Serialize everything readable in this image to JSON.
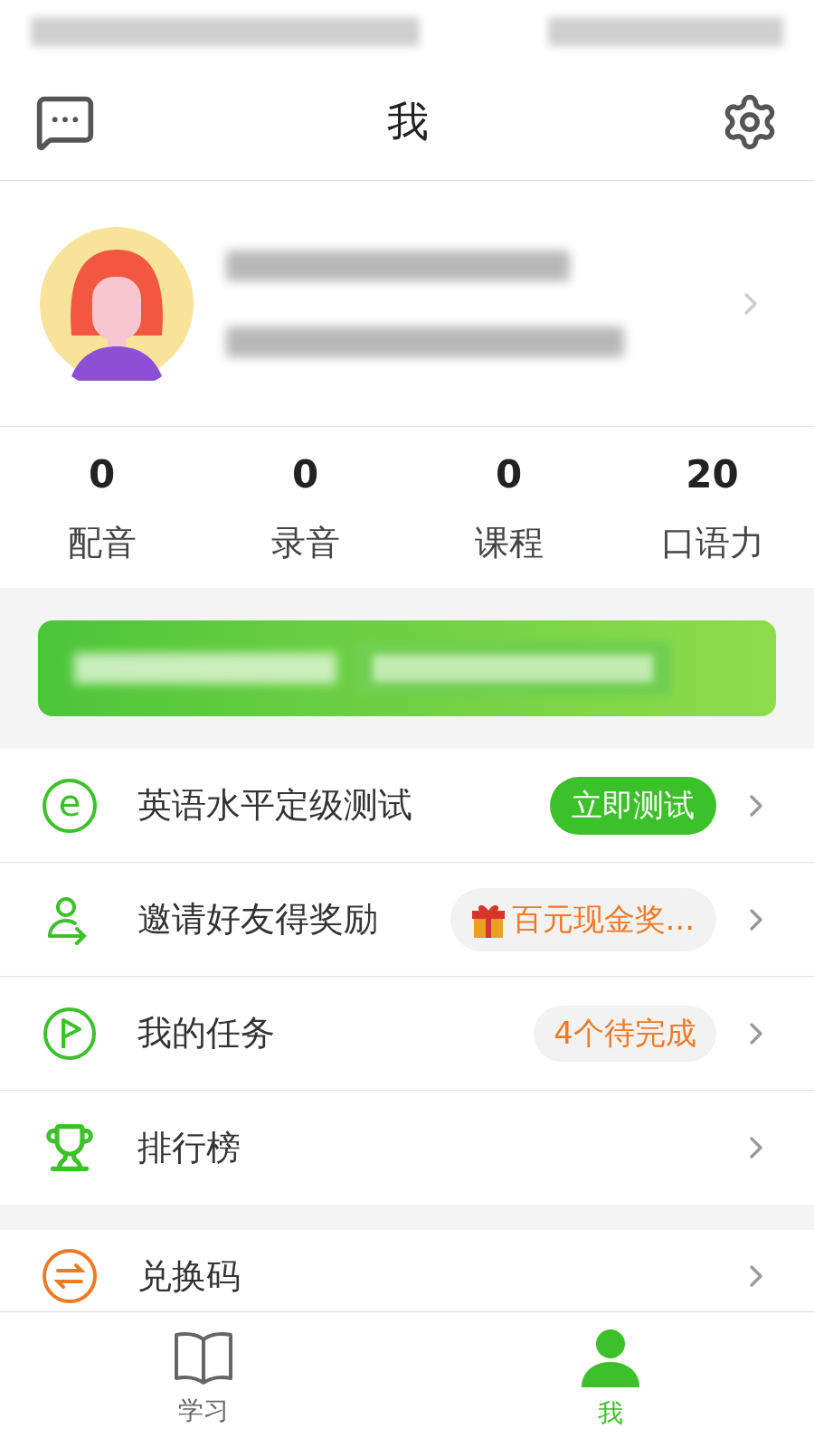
{
  "header": {
    "title": "我"
  },
  "stats": [
    {
      "value": "0",
      "label": "配音"
    },
    {
      "value": "0",
      "label": "录音"
    },
    {
      "value": "0",
      "label": "课程"
    },
    {
      "value": "20",
      "label": "口语力"
    }
  ],
  "menu": [
    {
      "kind": "button",
      "glyph": "e",
      "color": "#3cc12a",
      "label": "英语水平定级测试",
      "action": "立即测试"
    },
    {
      "kind": "gift",
      "color": "#3cc12a",
      "label": "邀请好友得奖励",
      "action": "百元现金奖..."
    },
    {
      "kind": "pill",
      "color": "#3cc12a",
      "label": "我的任务",
      "action": "4个待完成"
    },
    {
      "kind": "none",
      "color": "#3cc12a",
      "label": "排行榜"
    }
  ],
  "menu2": [
    {
      "color": "#f07a24",
      "label": "兑换码"
    }
  ],
  "tabs": [
    {
      "label": "学习",
      "selected": false
    },
    {
      "label": "我",
      "selected": true
    }
  ]
}
